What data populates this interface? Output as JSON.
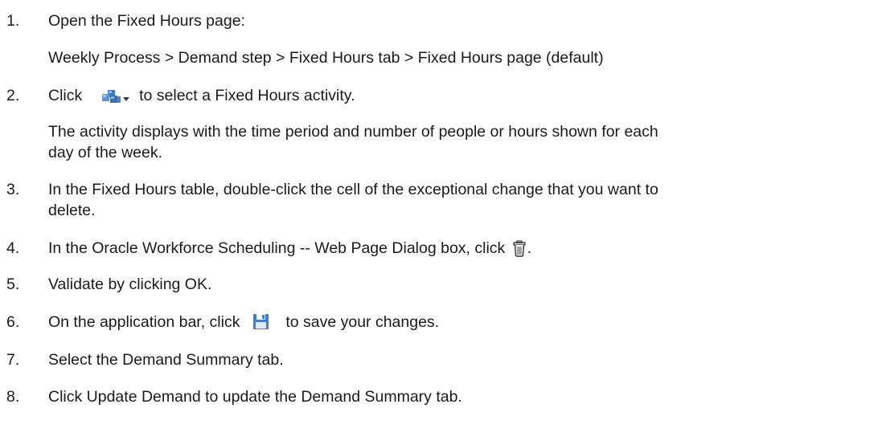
{
  "steps": [
    {
      "number": "1.",
      "text": "Open the Fixed Hours page:",
      "detail": "Weekly Process > Demand step > Fixed Hours tab > Fixed Hours page (default)"
    },
    {
      "number": "2.",
      "text_before": "Click",
      "icon": "activity-blocks-dropdown-icon",
      "text_after": "to select a Fixed Hours activity.",
      "detail_line1": "The activity displays with the time period and number of people or hours shown for each",
      "detail_line2": "day of the week."
    },
    {
      "number": "3.",
      "line1": "In the Fixed Hours table, double-click the cell of the exceptional change that you want to",
      "line2": "delete."
    },
    {
      "number": "4.",
      "text_before": "In the Oracle Workforce Scheduling -- Web Page Dialog box, click",
      "icon": "trash-can-icon",
      "text_after": "."
    },
    {
      "number": "5.",
      "text": "Validate by clicking OK."
    },
    {
      "number": "6.",
      "text_before": "On the application bar, click",
      "icon": "save-disk-icon",
      "text_after": "to save your changes."
    },
    {
      "number": "7.",
      "text": "Select the Demand Summary tab."
    },
    {
      "number": "8.",
      "text": "Click Update Demand to update the Demand Summary tab."
    }
  ],
  "colors": {
    "text": "#1a1a1a",
    "activity_icon_blue": "#4a86c8",
    "save_icon_blue": "#3f7fcf"
  }
}
